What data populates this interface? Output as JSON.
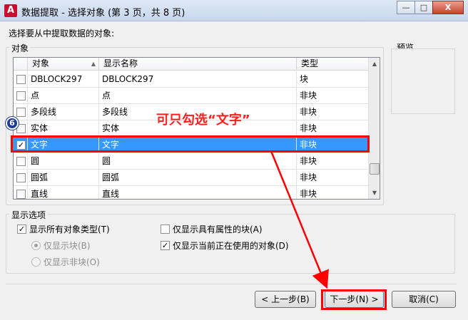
{
  "window": {
    "app_icon": "A",
    "title": "数据提取 - 选择对象 (第 3 页，共 8 页)",
    "minimize": "—",
    "maximize": "□",
    "close": "X"
  },
  "instruction": "选择要从中提取数据的对象:",
  "objects_group": {
    "label": "对象",
    "columns": [
      "对象",
      "显示名称",
      "类型"
    ],
    "sort_indicator": "▲",
    "rows": [
      {
        "object": "DBLOCK297",
        "display_name": "DBLOCK297",
        "type": "块",
        "checked": false,
        "selected": false
      },
      {
        "object": "点",
        "display_name": "点",
        "type": "非块",
        "checked": false,
        "selected": false
      },
      {
        "object": "多段线",
        "display_name": "多段线",
        "type": "非块",
        "checked": false,
        "selected": false
      },
      {
        "object": "实体",
        "display_name": "实体",
        "type": "非块",
        "checked": false,
        "selected": false
      },
      {
        "object": "文字",
        "display_name": "文字",
        "type": "非块",
        "checked": true,
        "selected": true
      },
      {
        "object": "圆",
        "display_name": "圆",
        "type": "非块",
        "checked": false,
        "selected": false
      },
      {
        "object": "圆弧",
        "display_name": "圆弧",
        "type": "非块",
        "checked": false,
        "selected": false
      },
      {
        "object": "直线",
        "display_name": "直线",
        "type": "非块",
        "checked": false,
        "selected": false
      }
    ]
  },
  "preview_group": {
    "label": "预览"
  },
  "display_options": {
    "label": "显示选项",
    "show_all_types": {
      "label": "显示所有对象类型(T)",
      "checked": true
    },
    "blocks_only": {
      "label": "仅显示块(B)",
      "selected": true,
      "enabled": false
    },
    "non_blocks_only": {
      "label": "仅显示非块(O)",
      "selected": false,
      "enabled": false
    },
    "blocks_with_attributes": {
      "label": "仅显示具有属性的块(A)",
      "checked": false
    },
    "objects_in_use": {
      "label": "仅显示当前正在使用的对象(D)",
      "checked": true
    }
  },
  "buttons": {
    "back": "< 上一步(B)",
    "next": "下一步(N) >",
    "cancel": "取消(C)"
  },
  "annotation": {
    "step_number": "6",
    "text": "可只勾选“文字”",
    "color": "#ff0000"
  },
  "colors": {
    "selection": "#3399ff",
    "annotation_red": "#ff0000",
    "step_badge": "#1e3c96"
  }
}
